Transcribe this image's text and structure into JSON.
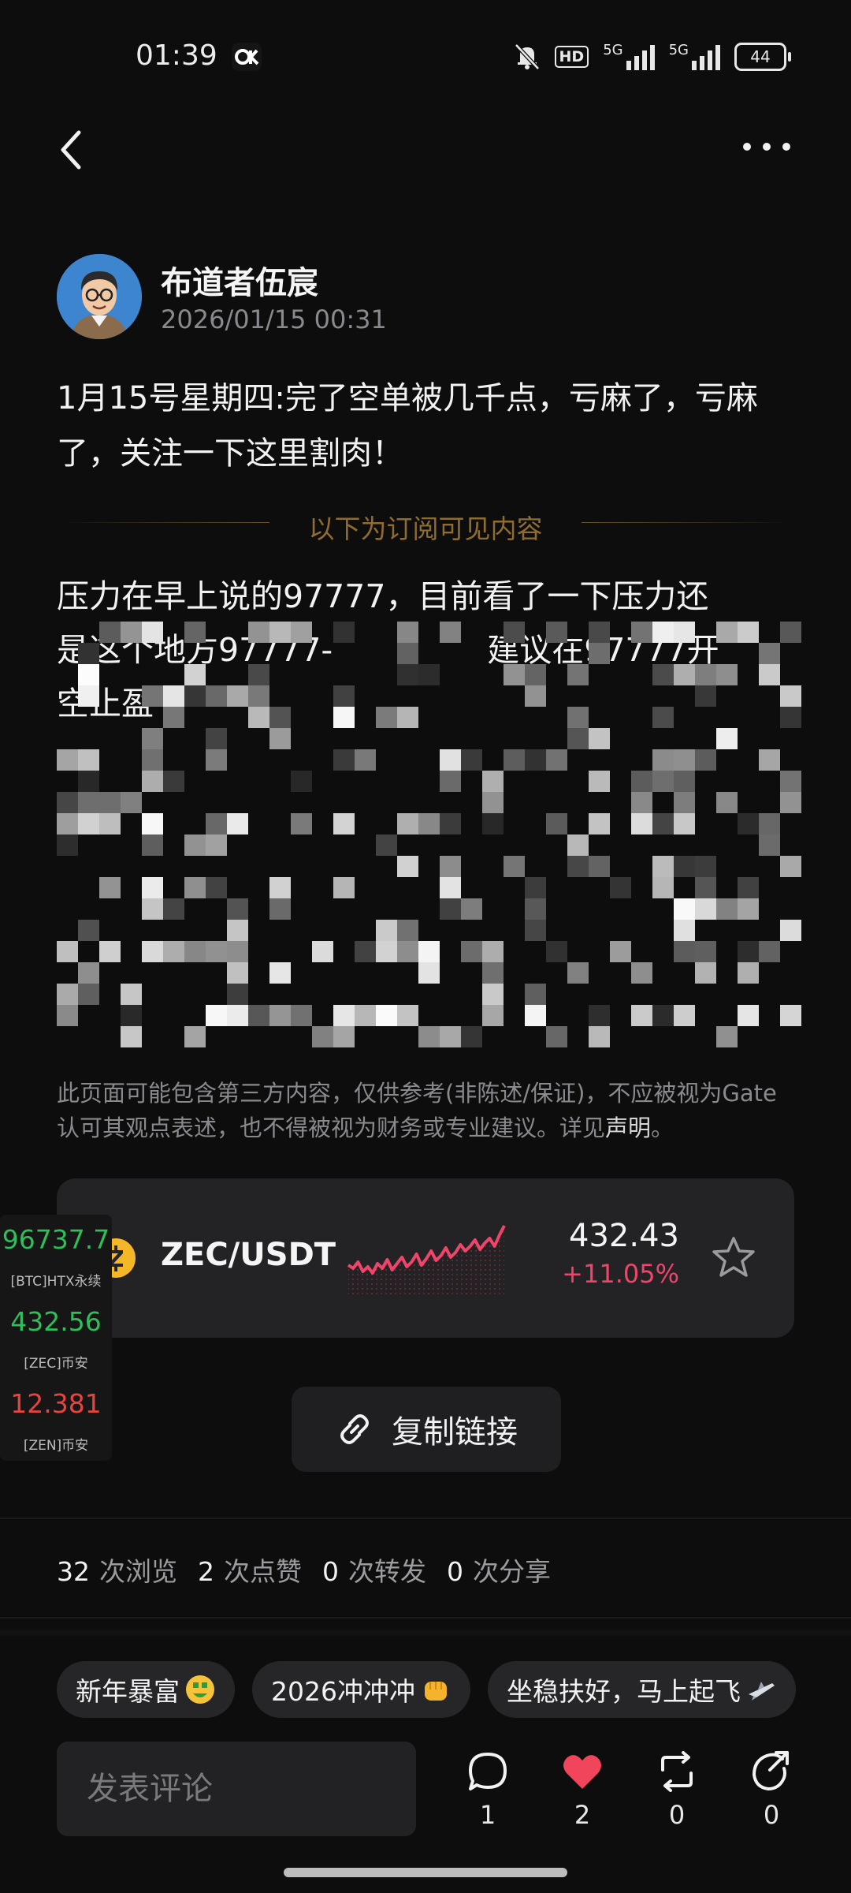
{
  "status": {
    "time": "01:39",
    "net1": "5G",
    "net2": "5G",
    "battery": "44",
    "hd": "HD"
  },
  "post": {
    "author": "布道者伍宸",
    "timestamp": "2026/01/15 00:31",
    "title": "1月15号星期四:完了空单被几千点，亏麻了，亏麻了，关注一下这里割肉！",
    "subscribe_divider": "以下为订阅可见内容",
    "body_line1": "压力在早上说的97777，目前看了一下压力还",
    "body_line2": "是这个地方97777-",
    "body_line2b": "建议在97777开",
    "body_line3": "空止盈",
    "disclaimer": "此页面可能包含第三方内容，仅供参考(非陈述/保证)，不应被视为Gate认可其观点表述，也不得被视为财务或专业建议。详见",
    "disclaimer_link": "声明",
    "disclaimer_end": "。"
  },
  "ticker": {
    "pair": "ZEC/USDT",
    "price": "432.43",
    "change": "+11.05%",
    "up_color": "#f0456a"
  },
  "widget": {
    "rows": [
      {
        "value": "96737.7",
        "label": "[BTC]HTX永续",
        "color": "#2fbf5a"
      },
      {
        "value": "432.56",
        "label": "[ZEC]币安",
        "color": "#2fbf5a"
      },
      {
        "value": "12.381",
        "label": "[ZEN]币安",
        "color": "#e5443f"
      }
    ]
  },
  "copy_link_label": "复制链接",
  "stats": [
    {
      "num": "32",
      "label": "次浏览"
    },
    {
      "num": "2",
      "label": "次点赞"
    },
    {
      "num": "0",
      "label": "次转发"
    },
    {
      "num": "0",
      "label": "次分享"
    }
  ],
  "tags": [
    {
      "label": "新年暴富",
      "icon": "money-mouth-emoji-icon"
    },
    {
      "label": "2026冲冲冲",
      "icon": "fist-emoji-icon"
    },
    {
      "label": "坐稳扶好，马上起飞",
      "icon": "airplane-emoji-icon"
    }
  ],
  "bottom": {
    "comment_placeholder": "发表评论",
    "comment_count": "1",
    "like_count": "2",
    "repost_count": "0",
    "share_count": "0",
    "like_color": "#f0455a"
  }
}
